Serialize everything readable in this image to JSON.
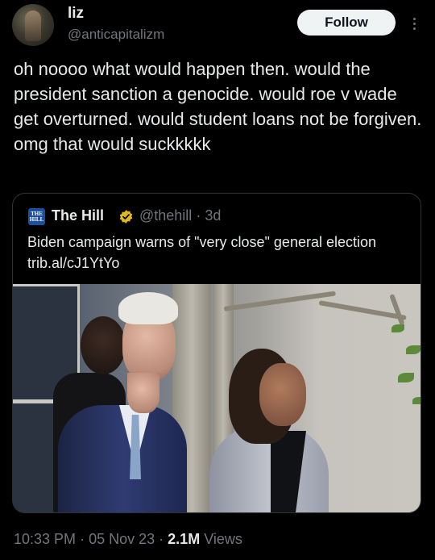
{
  "tweet": {
    "display_name": "liz",
    "handle": "@anticapitalizm",
    "follow_label": "Follow",
    "text": "oh noooo what would happen then. would the president sanction a genocide. would roe v wade get overturned. would student loans not be forgiven. omg that would suckkkkk"
  },
  "quote": {
    "logo_text": "THE HILL",
    "display_name": "The Hill",
    "verified_color": "#e2b719",
    "handle": "@thehill",
    "separator": "·",
    "age": "3d",
    "text": "Biden campaign warns of \"very close\" general election trib.al/cJ1YtYo"
  },
  "footer": {
    "time": "10:33 PM",
    "sep1": "·",
    "date": "05 Nov 23",
    "sep2": "·",
    "views_count": "2.1M",
    "views_label": "Views"
  },
  "colors": {
    "background": "#000000",
    "text": "#e7e9ea",
    "secondary": "#71767b",
    "follow_bg": "#eff3f4"
  }
}
